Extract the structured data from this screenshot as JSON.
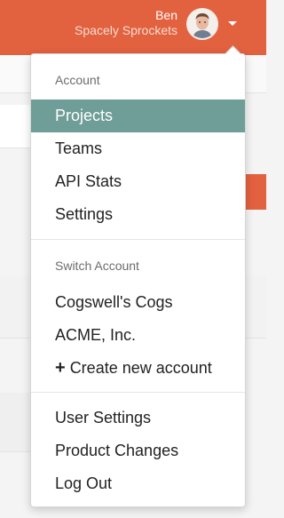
{
  "header": {
    "user_name": "Ben",
    "org_name": "Spacely Sprockets",
    "brand_color": "#e2613f"
  },
  "menu": {
    "account_heading": "Account",
    "account_items": [
      "Projects",
      "Teams",
      "API Stats",
      "Settings"
    ],
    "active_item": "Projects",
    "switch_heading": "Switch Account",
    "switch_items": [
      "Cogswell's Cogs",
      "ACME, Inc."
    ],
    "create_label": "Create new account",
    "create_icon": "plus-icon",
    "user_items": [
      "User Settings",
      "Product Changes",
      "Log Out"
    ],
    "active_color": "#6e9e97"
  }
}
